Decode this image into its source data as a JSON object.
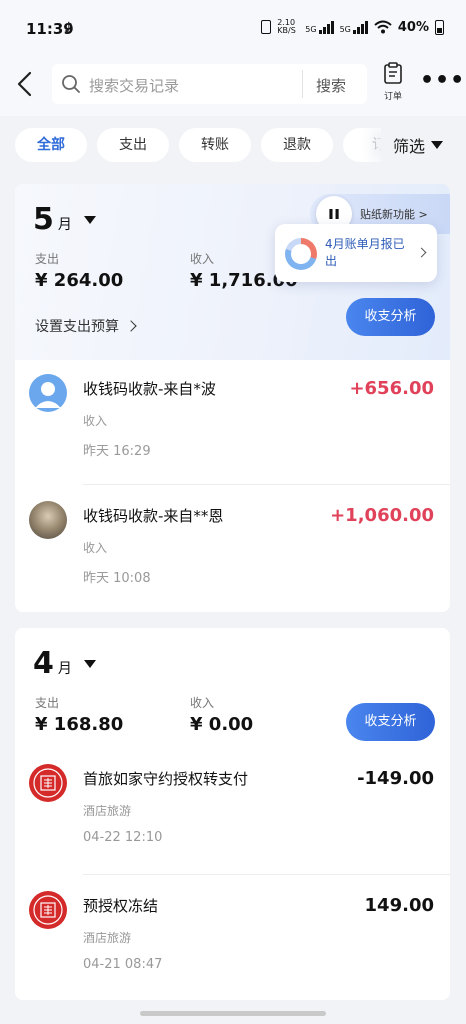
{
  "status_bar": {
    "time": "11:39",
    "network_speed": "2.10\nKB/S",
    "signal1": "5G",
    "signal2": "5G",
    "battery": "40%"
  },
  "nav": {
    "search_placeholder": "搜索交易记录",
    "search_button": "搜索",
    "order_label": "订单"
  },
  "filters": {
    "chips": [
      "全部",
      "支出",
      "转账",
      "退款",
      "订"
    ],
    "active_index": 0,
    "filter_button": "筛选"
  },
  "banner": {
    "sticker_text": "贴纸新功能",
    "sticker_chev": ">",
    "report_text": "4月账单月报已出"
  },
  "months": [
    {
      "month": "5",
      "unit": "月",
      "expense_label": "支出",
      "expense": "¥ 264.00",
      "income_label": "收入",
      "income": "¥ 1,716.00",
      "budget_link": "设置支出预算",
      "analysis_button": "收支分析",
      "transactions": [
        {
          "title": "收钱码收款-来自*波",
          "type": "收入",
          "time": "昨天 16:29",
          "amount": "+656.00",
          "kind": "income",
          "avatar": "default"
        },
        {
          "title": "收钱码收款-来自**恩",
          "type": "收入",
          "time": "昨天 10:08",
          "amount": "+1,060.00",
          "kind": "income",
          "avatar": "photo"
        }
      ]
    },
    {
      "month": "4",
      "unit": "月",
      "expense_label": "支出",
      "expense": "¥ 168.80",
      "income_label": "收入",
      "income": "¥ 0.00",
      "analysis_button": "收支分析",
      "transactions": [
        {
          "title": "首旅如家守约授权转支付",
          "type": "酒店旅游",
          "time": "04-22 12:10",
          "amount": "-149.00",
          "kind": "expense",
          "avatar": "seal"
        },
        {
          "title": "预授权冻结",
          "type": "酒店旅游",
          "time": "04-21 08:47",
          "amount": "149.00",
          "kind": "expense",
          "avatar": "seal"
        }
      ]
    }
  ],
  "colors": {
    "accent": "#2f6bd9",
    "income": "#e0425a",
    "seal_red": "#d42a2a"
  }
}
